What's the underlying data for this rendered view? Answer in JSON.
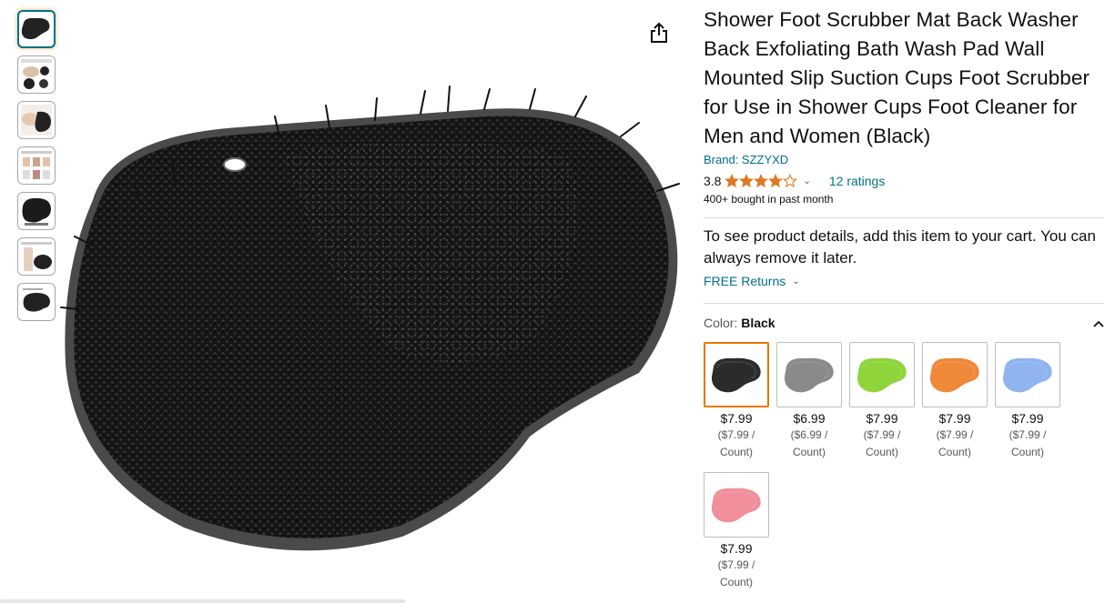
{
  "thumbnails": [
    {
      "name": "thumb-1",
      "icon": "mat-black-icon",
      "selected": true
    },
    {
      "name": "thumb-2",
      "icon": "usage-infographic-icon",
      "selected": false
    },
    {
      "name": "thumb-3",
      "icon": "foot-scrub-photo-icon",
      "selected": false
    },
    {
      "name": "thumb-4",
      "icon": "steps-infographic-icon",
      "selected": false
    },
    {
      "name": "thumb-5",
      "icon": "mat-suction-icon",
      "selected": false
    },
    {
      "name": "thumb-6",
      "icon": "massage-infographic-icon",
      "selected": false
    },
    {
      "name": "thumb-7",
      "icon": "mat-size-icon",
      "selected": false
    }
  ],
  "product": {
    "title": "Shower Foot Scrubber Mat Back Washer Back Exfoliating Bath Wash Pad Wall Mounted Slip Suction Cups Foot Scrubber for Use in Shower Cups Foot Cleaner for Men and Women (Black)",
    "brand": "Brand: SZZYXD",
    "rating": "3.8",
    "rating_value": 3.8,
    "ratings_count": "12 ratings",
    "bought": "400+ bought in past month",
    "details_message": "To see product details, add this item to your cart. You can always remove it later.",
    "free_returns": "FREE Returns"
  },
  "color": {
    "label": "Color: ",
    "selected": "Black"
  },
  "swatches": [
    {
      "name": "black",
      "price": "$7.99",
      "unit_1": "($7.99 /",
      "unit_2": "Count)",
      "color": "#2b2b2b"
    },
    {
      "name": "gray",
      "price": "$6.99",
      "unit_1": "($6.99 /",
      "unit_2": "Count)",
      "color": "#8a8a8a"
    },
    {
      "name": "green",
      "price": "$7.99",
      "unit_1": "($7.99 /",
      "unit_2": "Count)",
      "color": "#8fd43a"
    },
    {
      "name": "orange",
      "price": "$7.99",
      "unit_1": "($7.99 /",
      "unit_2": "Count)",
      "color": "#f0883a"
    },
    {
      "name": "blue",
      "price": "$7.99",
      "unit_1": "($7.99 /",
      "unit_2": "Count)",
      "color": "#8fb4f0"
    },
    {
      "name": "pink",
      "price": "$7.99",
      "unit_1": "($7.99 /",
      "unit_2": "Count)",
      "color": "#f08e9b"
    }
  ],
  "colors": {
    "link": "#007185",
    "star": "#de7921",
    "selected_border": "#e77600",
    "mat": "#1e1e1e"
  }
}
